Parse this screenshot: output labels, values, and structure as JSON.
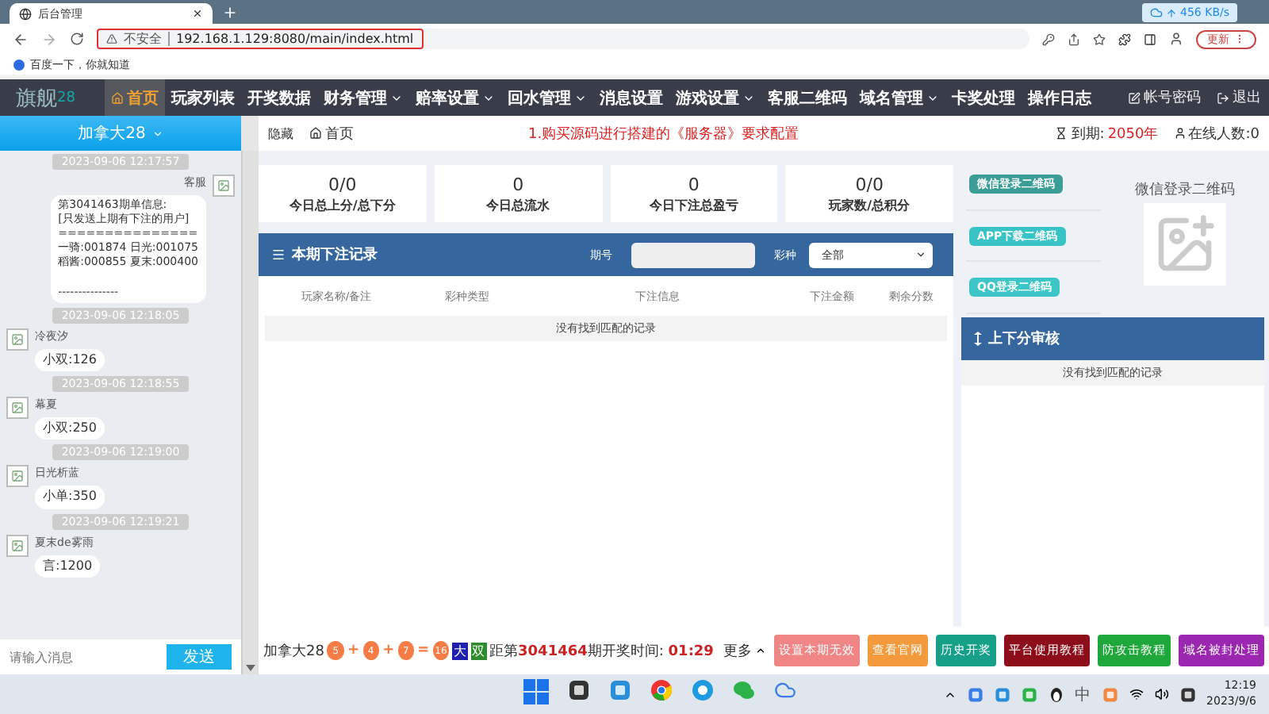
{
  "browser": {
    "tab_title": "后台管理",
    "download_speed": "456 KB/s",
    "address": {
      "security": "不安全",
      "url": "192.168.1.129:8080/main/index.html"
    },
    "update_button": "更新",
    "bookmarks": [
      "百度一下，你就知道"
    ]
  },
  "nav": {
    "logo": "旗舰",
    "logo_suffix": "28",
    "items": [
      {
        "label": "首页",
        "selected": true,
        "dropdown": false
      },
      {
        "label": "玩家列表",
        "selected": false,
        "dropdown": false
      },
      {
        "label": "开奖数据",
        "selected": false,
        "dropdown": false
      },
      {
        "label": "财务管理",
        "selected": false,
        "dropdown": true
      },
      {
        "label": "赔率设置",
        "selected": false,
        "dropdown": true
      },
      {
        "label": "回水管理",
        "selected": false,
        "dropdown": true
      },
      {
        "label": "消息设置",
        "selected": false,
        "dropdown": false
      },
      {
        "label": "游戏设置",
        "selected": false,
        "dropdown": true
      },
      {
        "label": "客服二维码",
        "selected": false,
        "dropdown": false
      },
      {
        "label": "域名管理",
        "selected": false,
        "dropdown": true
      },
      {
        "label": "卡奖处理",
        "selected": false,
        "dropdown": false
      },
      {
        "label": "操作日志",
        "selected": false,
        "dropdown": false
      }
    ],
    "account": "帐号密码",
    "logout": "退出"
  },
  "subbar": {
    "game_selector": "加拿大28",
    "hide": "隐藏",
    "breadcrumb": "首页",
    "notice": "1.购买源码进行搭建的《服务器》要求配置",
    "expiry_label": "到期:",
    "expiry": "2050年",
    "online": "在线人数:0"
  },
  "chat": {
    "messages": [
      {
        "time": "2023-09-06 12:17:57",
        "sender": "客服",
        "kind": "outgoing",
        "text": "第3041463期单信息:\n[只发送上期有下注的用户]\n===============\n一骑:001874 日光:001075\n稻酱:000855 夏末:000400\n\n---------------"
      },
      {
        "time": "2023-09-06 12:18:05",
        "sender": "冷夜汐",
        "kind": "incoming",
        "text": "小双:126"
      },
      {
        "time": "2023-09-06 12:18:55",
        "sender": "幕夏",
        "kind": "incoming",
        "text": "小双:250"
      },
      {
        "time": "2023-09-06 12:19:00",
        "sender": "日光析蓝",
        "kind": "incoming",
        "text": "小单:350"
      },
      {
        "time": "2023-09-06 12:19:21",
        "sender": "夏末de雾雨",
        "kind": "incoming",
        "text": "言:1200"
      }
    ],
    "input": {
      "placeholder": "请输入消息"
    },
    "send": "发送"
  },
  "stats": [
    {
      "value": "0/0",
      "label": "今日总上分/总下分"
    },
    {
      "value": "0",
      "label": "今日总流水"
    },
    {
      "value": "0",
      "label": "今日下注总盈亏"
    },
    {
      "value": "0/0",
      "label": "玩家数/总积分"
    }
  ],
  "bets": {
    "title": "本期下注记录",
    "issue_label": "期号",
    "type_label": "彩种",
    "type_select": "全部",
    "columns": [
      "玩家名称/备注",
      "彩种类型",
      "下注信息",
      "下注金额",
      "剩余分数"
    ],
    "empty": "没有找到匹配的记录"
  },
  "qr": {
    "buttons": [
      {
        "label": "微信登录二维码",
        "color": "#3a9e96"
      },
      {
        "label": "APP下载二维码",
        "color": "#38c3c6"
      },
      {
        "label": "QQ登录二维码",
        "color": "#3cc6c8"
      }
    ],
    "title": "微信登录二维码"
  },
  "review": {
    "title": "上下分审核",
    "empty": "没有找到匹配的记录"
  },
  "footer": {
    "game": "加拿大28",
    "draw": [
      {
        "text": "5",
        "kind": "ball"
      },
      {
        "text": "+",
        "kind": "op"
      },
      {
        "text": "4",
        "kind": "ball"
      },
      {
        "text": "+",
        "kind": "op"
      },
      {
        "text": "7",
        "kind": "ball"
      },
      {
        "text": "=",
        "kind": "op"
      },
      {
        "text": "16",
        "kind": "ball"
      }
    ],
    "tags": [
      {
        "text": "大",
        "color": "#1f1fae"
      },
      {
        "text": "双",
        "color": "#2e8b2e"
      }
    ],
    "before": "距第",
    "issue": "3041464",
    "after": "期开奖时间:",
    "countdown": "01:29",
    "more": "更多",
    "buttons": [
      {
        "label": "设置本期无效",
        "color": "#f08585"
      },
      {
        "label": "查看官网",
        "color": "#f39a3c"
      },
      {
        "label": "历史开奖",
        "color": "#16a08a"
      },
      {
        "label": "平台使用教程",
        "color": "#8e0d1a"
      },
      {
        "label": "防攻击教程",
        "color": "#1ea73a"
      },
      {
        "label": "域名被封处理",
        "color": "#9b27b0"
      }
    ]
  },
  "taskbar": {
    "tray_lang": "中",
    "time": "12:19",
    "date": "2023/9/6"
  }
}
